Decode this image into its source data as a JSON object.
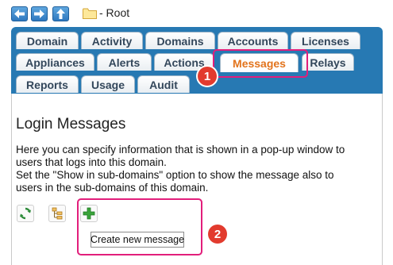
{
  "colors": {
    "tab_panel": "#2779b3",
    "active_tab_text": "#e2731c",
    "highlight": "#e21e7b",
    "badge": "#e23b2e",
    "add_icon": "#3aa43a",
    "refresh_icon": "#2e8b3a"
  },
  "toolbar_nav": {
    "back_icon": "arrow-left-icon",
    "forward_icon": "arrow-right-icon",
    "up_icon": "arrow-up-icon"
  },
  "location": {
    "folder_icon": "folder-icon",
    "label": "- Root"
  },
  "tabs": [
    {
      "label": "Domain"
    },
    {
      "label": "Activity"
    },
    {
      "label": "Domains"
    },
    {
      "label": "Accounts"
    },
    {
      "label": "Licenses"
    },
    {
      "label": "Appliances"
    },
    {
      "label": "Alerts"
    },
    {
      "label": "Actions"
    },
    {
      "label": "Messages"
    },
    {
      "label": "Relays"
    },
    {
      "label": "Reports"
    },
    {
      "label": "Usage"
    },
    {
      "label": "Audit"
    }
  ],
  "active_tab": "Messages",
  "annotations": {
    "badge_1": "1",
    "badge_2": "2"
  },
  "content": {
    "title": "Login Messages",
    "lines": [
      "Here you can specify information that is shown in a pop-up window to",
      "users that logs into this domain.",
      "Set the \"Show in sub-domains\" option to show the message also to",
      "users in the sub-domains of this domain."
    ]
  },
  "tools": {
    "refresh_icon": "refresh-icon",
    "tree_icon": "tree-icon",
    "add_icon": "add-icon",
    "tooltip": "Create new message"
  }
}
